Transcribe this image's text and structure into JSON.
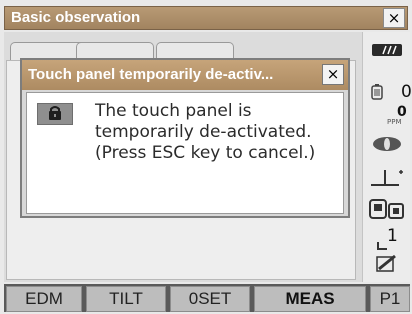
{
  "window": {
    "title": "Basic observation",
    "close_label": "×"
  },
  "dialog": {
    "title": "Touch panel temporarily de-activ...",
    "close_label": "×",
    "message_lines": [
      "The touch panel is",
      "temporarily de-activated.",
      "(Press ESC key to cancel.)"
    ]
  },
  "status": {
    "signal_label": "/ / /",
    "value_0": "0",
    "ppm_value": "0",
    "ppm_unit": "PPM",
    "page_number": "1"
  },
  "softkeys": [
    {
      "label": "EDM",
      "active": false
    },
    {
      "label": "TILT",
      "active": false
    },
    {
      "label": "0SET",
      "active": false
    },
    {
      "label": "MEAS",
      "active": true
    },
    {
      "label": "P1",
      "active": false
    }
  ]
}
